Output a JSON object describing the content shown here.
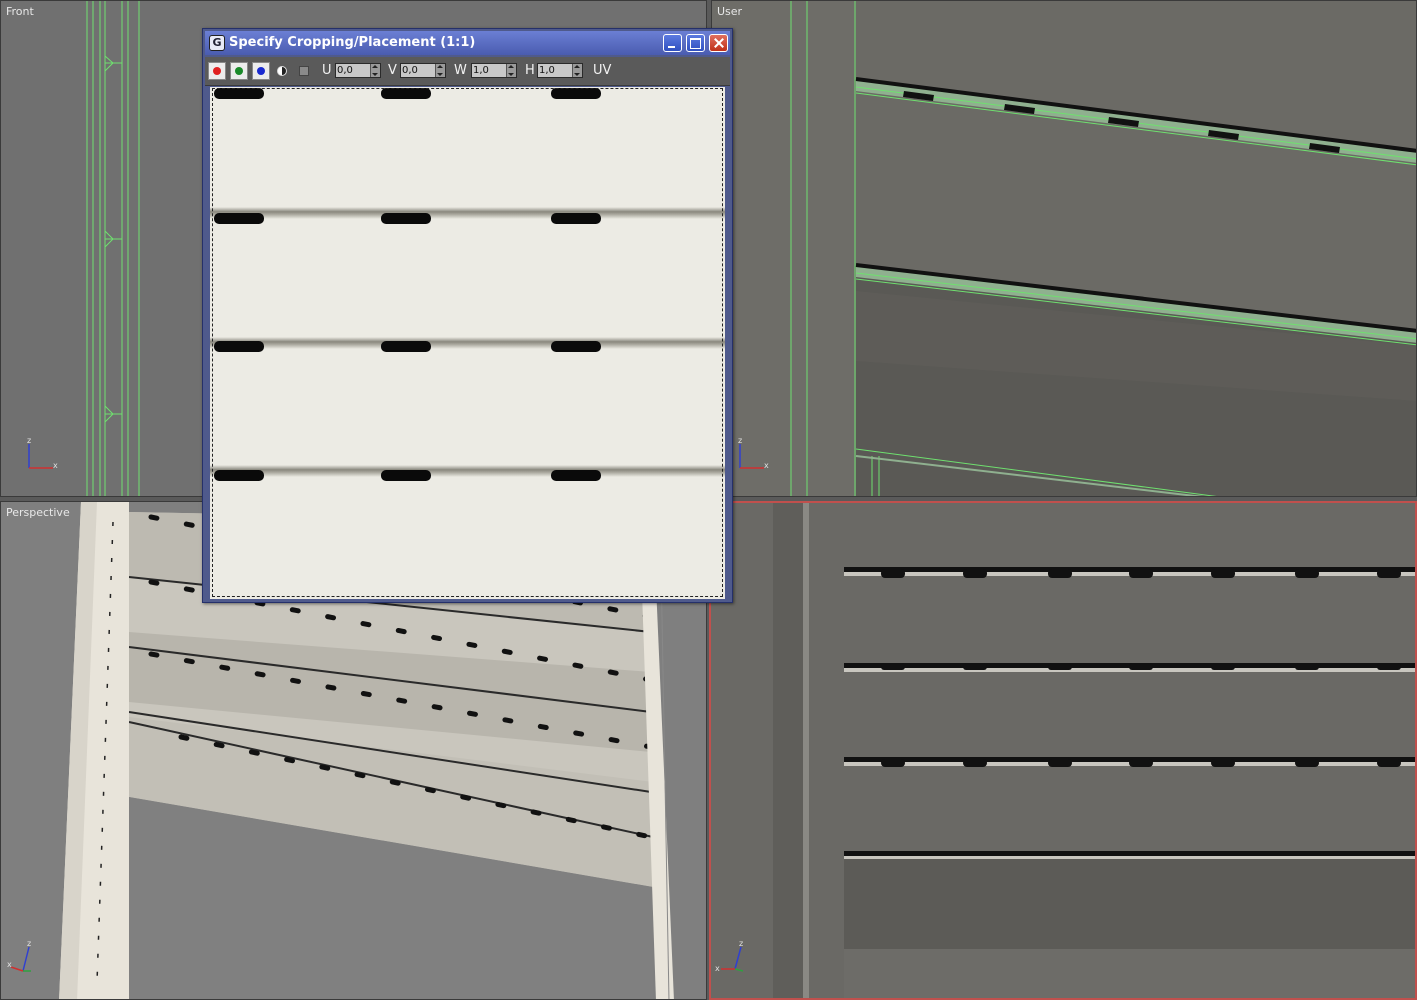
{
  "viewports": {
    "front": {
      "label": "Front",
      "axis": {
        "z": "z",
        "x": "x"
      }
    },
    "user": {
      "label": "User",
      "axis": {
        "z": "z",
        "x": "x"
      }
    },
    "perspective": {
      "label": "Perspective",
      "axis": {
        "z": "z",
        "x": "x"
      }
    },
    "active": {
      "axis": {
        "z": "z",
        "x": "x"
      }
    }
  },
  "dialog": {
    "title": "Specify Cropping/Placement (1:1)",
    "icon": "3ds-max-logo-icon",
    "toolbar": {
      "channels": [
        {
          "name": "red-channel",
          "color": "#e02020"
        },
        {
          "name": "green-channel",
          "color": "#1a8a2a"
        },
        {
          "name": "blue-channel",
          "color": "#1a2ad0"
        }
      ],
      "fields": [
        {
          "label": "U",
          "value": "0,0"
        },
        {
          "label": "V",
          "value": "0,0"
        },
        {
          "label": "W",
          "value": "1,0"
        },
        {
          "label": "H",
          "value": "1,0"
        }
      ],
      "mode_label": "UV"
    }
  },
  "colors": {
    "dialog_frame": "#4f5a8c",
    "title_gradient_top": "#6b7fd4",
    "active_viewport_border": "#c0504d",
    "wireframe": "#6fe06f"
  }
}
